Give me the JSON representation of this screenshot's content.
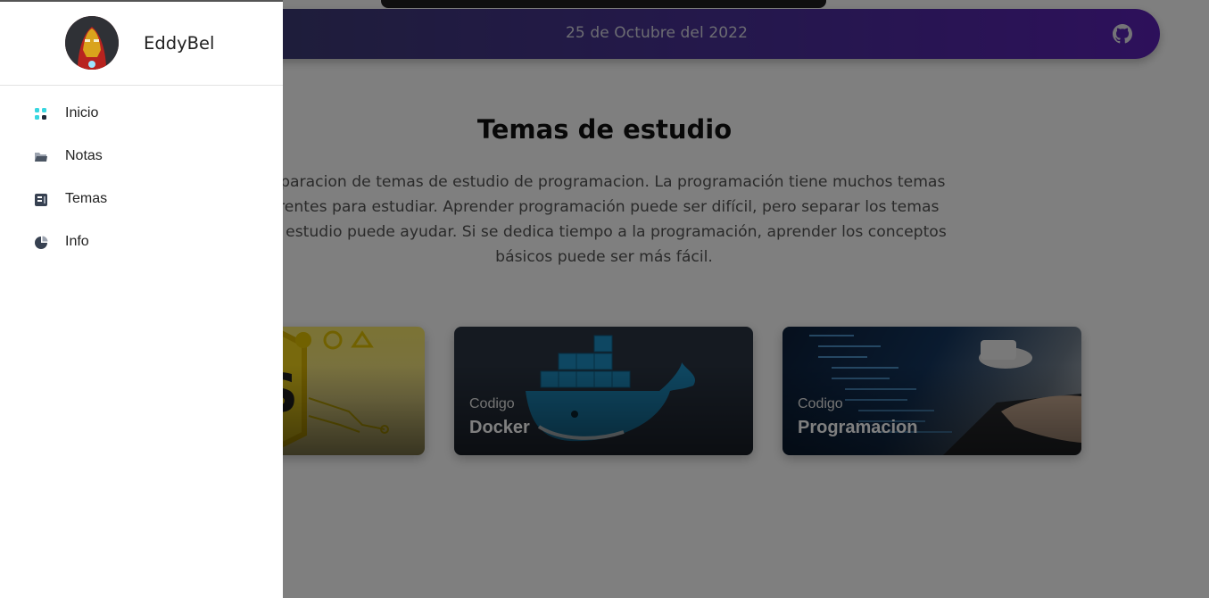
{
  "header": {
    "date": "25 de Octubre del 2022",
    "github_icon": "github-icon"
  },
  "main": {
    "title": "Temas de estudio",
    "description": "separacion de temas de estudio de programacion. La programación tiene muchos temas erentes para estudiar. Aprender programación puede ser difícil, pero separar los temas de estudio puede ayudar. Si se dedica tiempo a la programación, aprender los conceptos básicos puede ser más fácil.",
    "cards": [
      {
        "subtitle": "",
        "title": ""
      },
      {
        "subtitle": "Codigo",
        "title": "Docker"
      },
      {
        "subtitle": "Codigo",
        "title": "Programacion"
      }
    ]
  },
  "drawer": {
    "username": "EddyBel",
    "items": [
      {
        "label": "Inicio",
        "icon": "grid-icon"
      },
      {
        "label": "Notas",
        "icon": "folder-icon"
      },
      {
        "label": "Temas",
        "icon": "book-icon"
      },
      {
        "label": "Info",
        "icon": "pie-chart-icon"
      }
    ]
  },
  "colors": {
    "header_gradient_start": "#3a3d6e",
    "header_gradient_end": "#5b21b6",
    "overlay": "rgba(0,0,0,0.5)",
    "drawer_bg": "#ffffff"
  }
}
